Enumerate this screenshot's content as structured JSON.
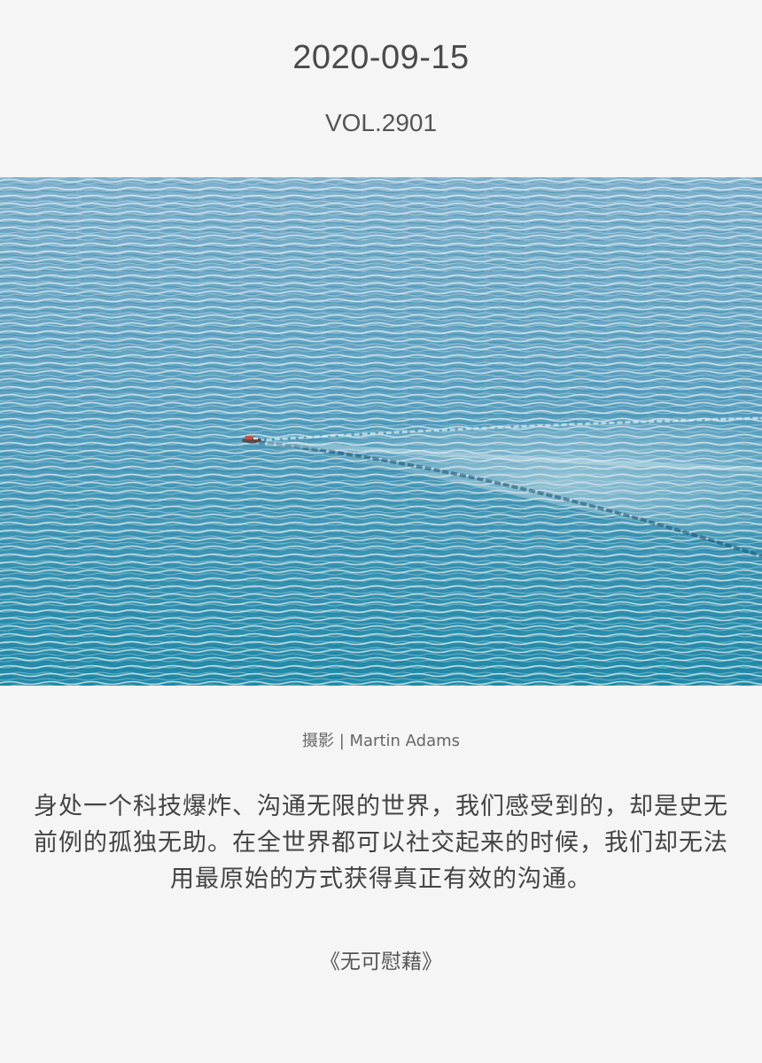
{
  "header": {
    "date": "2020-09-15",
    "volume": "VOL.2901"
  },
  "photo": {
    "subject": "boat-on-sea-photo",
    "colors": {
      "sea_top": "#7fb0cc",
      "sea_bottom": "#1f8aa8",
      "wave_light": "#e3eef4",
      "wake": "#b9d4e0"
    }
  },
  "credit": {
    "text": "摄影 | Martin Adams"
  },
  "quote": {
    "text": "身处一个科技爆炸、沟通无限的世界，我们感受到的，却是史无前例的孤独无助。在全世界都可以社交起来的时候，我们却无法用最原始的方式获得真正有效的沟通。"
  },
  "source": {
    "text": "《无可慰藉》"
  }
}
